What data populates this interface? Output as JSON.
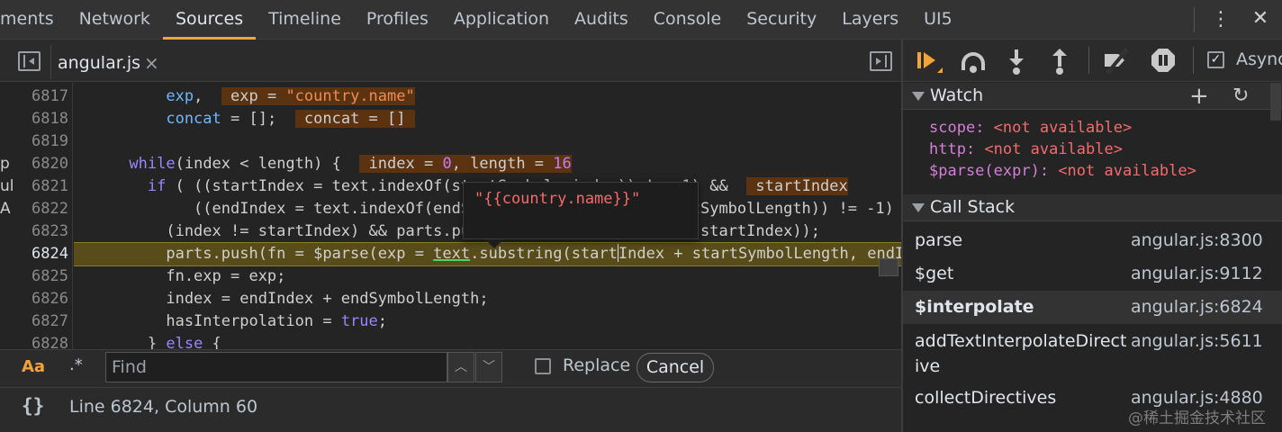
{
  "devtools_tabs": [
    "ments",
    "Network",
    "Sources",
    "Timeline",
    "Profiles",
    "Application",
    "Audits",
    "Console",
    "Security",
    "Layers",
    "UI5"
  ],
  "active_tab": "Sources",
  "file_tab": {
    "name": "angular.js",
    "close": "×"
  },
  "line_numbers": [
    "6817",
    "6818",
    "6819",
    "6820",
    "6821",
    "6822",
    "6823",
    "6824",
    "6825",
    "6826",
    "6827",
    "6828"
  ],
  "highlighted_line": "6824",
  "popover_value": "\"{{country.name}}\"",
  "search": {
    "case_label": "Aa",
    "regex_label": ".*",
    "placeholder": "Find",
    "replace_label": "Replace",
    "cancel_label": "Cancel"
  },
  "status": {
    "format_icon": "{}",
    "position": "Line 6824, Column 60"
  },
  "debugger": {
    "async_label": "Async",
    "async_checked": true
  },
  "watch": {
    "title": "Watch",
    "items": [
      {
        "name": "scope",
        "value": "<not available>"
      },
      {
        "name": "http",
        "value": "<not available>"
      },
      {
        "name": "$parse(expr)",
        "value": "<not available>"
      }
    ]
  },
  "call_stack": {
    "title": "Call Stack",
    "frames": [
      {
        "name": "parse",
        "location": "angular.js:8300"
      },
      {
        "name": "$get",
        "location": "angular.js:9112"
      },
      {
        "name": "$interpolate",
        "location": "angular.js:6824",
        "selected": true
      },
      {
        "name": "addTextInterpolateDirective",
        "location": "angular.js:5611"
      },
      {
        "name": "collectDirectives",
        "location": "angular.js:4880"
      }
    ]
  },
  "watermark": "@稀土掘金技术社区",
  "left_clip_chars": [
    "p",
    "ul",
    "A"
  ],
  "colors": {
    "accent": "#f2a33a",
    "keyword": "#9a86fd",
    "string": "#f28b54",
    "number": "#c27bff",
    "highlight_line": "#584c1b",
    "inline_value_bg": "#5b3310"
  }
}
